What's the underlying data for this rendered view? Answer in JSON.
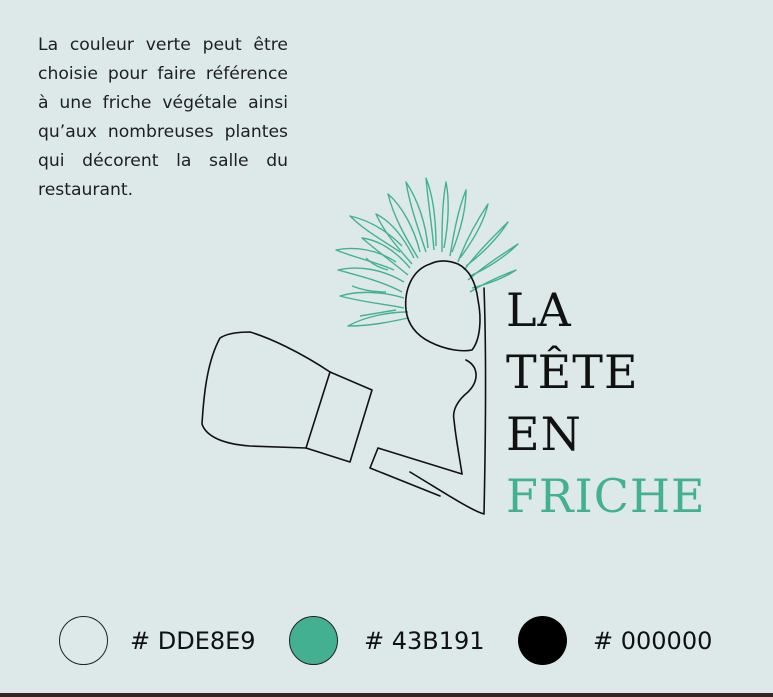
{
  "description": "La couleur verte peut être choisie pour faire référence à une friche végétale ainsi qu’aux nombreuses plantes qui décorent la salle du restaurant.",
  "logo": {
    "line1": "LA",
    "line2": "TÊTE",
    "line3": "EN",
    "line4": "FRICHE",
    "text_color": "#111111",
    "accent_color": "#43B191",
    "illustration": "line-drawing-head-with-leaf-hair-holding-box-icon"
  },
  "palette": [
    {
      "hex_label": "# DDE8E9",
      "color": "#DDE8E9"
    },
    {
      "hex_label": "# 43B191",
      "color": "#43B191"
    },
    {
      "hex_label": "# 000000",
      "color": "#000000"
    }
  ]
}
